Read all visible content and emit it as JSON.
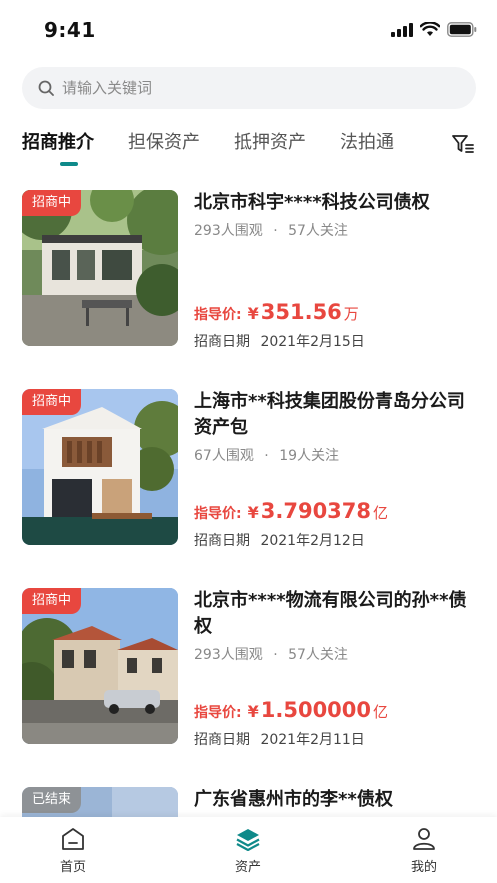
{
  "status_bar": {
    "time": "9:41"
  },
  "search": {
    "placeholder": "请输入关键词",
    "value": ""
  },
  "tabs": [
    {
      "label": "招商推介",
      "active": true
    },
    {
      "label": "担保资产",
      "active": false
    },
    {
      "label": "抵押资产",
      "active": false
    },
    {
      "label": "法拍通",
      "active": false
    }
  ],
  "filter_icon": "filter-icon",
  "listings": [
    {
      "status": "招商中",
      "title": "北京市科宇****科技公司债权",
      "views": "293人围观",
      "follows": "57人关注",
      "price_label": "指导价:",
      "currency": "¥",
      "price": "351.56",
      "unit": "万",
      "date_label": "招商日期",
      "date": "2021年2月15日"
    },
    {
      "status": "招商中",
      "title": "上海市**科技集团股份青岛分公司资产包",
      "views": "67人围观",
      "follows": "19人关注",
      "price_label": "指导价:",
      "currency": "¥",
      "price": "3.790378",
      "unit": "亿",
      "date_label": "招商日期",
      "date": "2021年2月12日"
    },
    {
      "status": "招商中",
      "title": "北京市****物流有限公司的孙**债权",
      "views": "293人围观",
      "follows": "57人关注",
      "price_label": "指导价:",
      "currency": "¥",
      "price": "1.500000",
      "unit": "亿",
      "date_label": "招商日期",
      "date": "2021年2月11日"
    },
    {
      "status": "已结束",
      "title": "广东省惠州市的李**债权"
    }
  ],
  "meta_separator": "·",
  "tabbar": [
    {
      "label": "首页",
      "icon": "home-icon",
      "active": false
    },
    {
      "label": "资产",
      "icon": "layers-icon",
      "active": true
    },
    {
      "label": "我的",
      "icon": "user-icon",
      "active": false
    }
  ],
  "colors": {
    "accent": "#0f8a8a",
    "price": "#e8473f",
    "badge_active": "#e8473f",
    "badge_ended": "#8e9296"
  }
}
